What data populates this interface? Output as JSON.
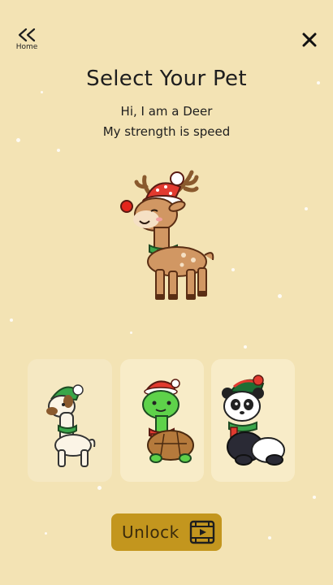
{
  "nav": {
    "home_label": "Home"
  },
  "header": {
    "title": "Select Your Pet",
    "intro": "Hi, I am a Deer",
    "strength": "My strength is speed"
  },
  "pets": [
    {
      "name": "Llama",
      "state": "locked"
    },
    {
      "name": "Turtle",
      "state": "locked"
    },
    {
      "name": "Panda",
      "state": "locked"
    }
  ],
  "selected_pet": "Deer",
  "unlock": {
    "label": "Unlock",
    "icon": "video-play-icon"
  },
  "colors": {
    "background": "#f3e3b4",
    "card": "#f8ecc8",
    "button": "#c3961e",
    "button_text": "#3b2b0c"
  }
}
